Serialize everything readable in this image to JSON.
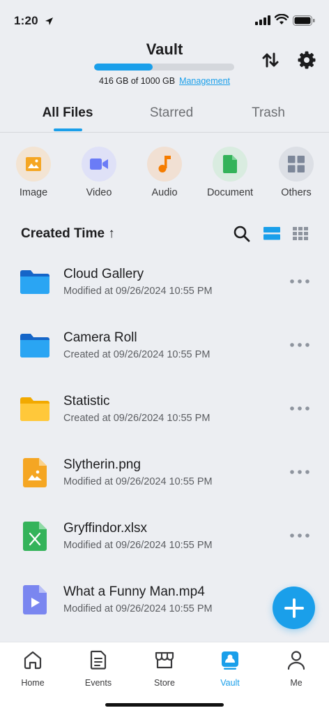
{
  "status_bar": {
    "time": "1:20"
  },
  "header": {
    "title": "Vault",
    "storage_used_fraction": 0.416,
    "storage_text": "416 GB of 1000 GB",
    "management_link": "Management"
  },
  "tabs": [
    {
      "label": "All Files",
      "active": true
    },
    {
      "label": "Starred",
      "active": false
    },
    {
      "label": "Trash",
      "active": false
    }
  ],
  "categories": [
    {
      "label": "Image",
      "icon": "image-icon",
      "color": "#f5a623"
    },
    {
      "label": "Video",
      "icon": "video-icon",
      "color": "#6b7cf6"
    },
    {
      "label": "Audio",
      "icon": "audio-icon",
      "color": "#f57c00"
    },
    {
      "label": "Document",
      "icon": "document-icon",
      "color": "#34b35a"
    },
    {
      "label": "Others",
      "icon": "grid-icon",
      "color": "#7d8799"
    }
  ],
  "sort": {
    "label": "Created Time ↑"
  },
  "files": [
    {
      "name": "Cloud Gallery",
      "meta": "Modified at 09/26/2024 10:55 PM",
      "type": "folder-blue"
    },
    {
      "name": "Camera Roll",
      "meta": "Created at 09/26/2024 10:55 PM",
      "type": "folder-blue"
    },
    {
      "name": "Statistic",
      "meta": "Created at 09/26/2024 10:55 PM",
      "type": "folder-yellow"
    },
    {
      "name": "Slytherin.png",
      "meta": "Modified at 09/26/2024 10:55 PM",
      "type": "image-file"
    },
    {
      "name": "Gryffindor.xlsx",
      "meta": "Modified at 09/26/2024 10:55 PM",
      "type": "excel-file"
    },
    {
      "name": "What a Funny Man.mp4",
      "meta": "Modified at 09/26/2024 10:55 PM",
      "type": "video-file"
    }
  ],
  "bottom_nav": [
    {
      "label": "Home",
      "icon": "home-icon",
      "active": false
    },
    {
      "label": "Events",
      "icon": "events-icon",
      "active": false
    },
    {
      "label": "Store",
      "icon": "store-icon",
      "active": false
    },
    {
      "label": "Vault",
      "icon": "vault-icon",
      "active": true
    },
    {
      "label": "Me",
      "icon": "person-icon",
      "active": false
    }
  ],
  "colors": {
    "accent": "#1a9fea",
    "background": "#eceef2"
  }
}
